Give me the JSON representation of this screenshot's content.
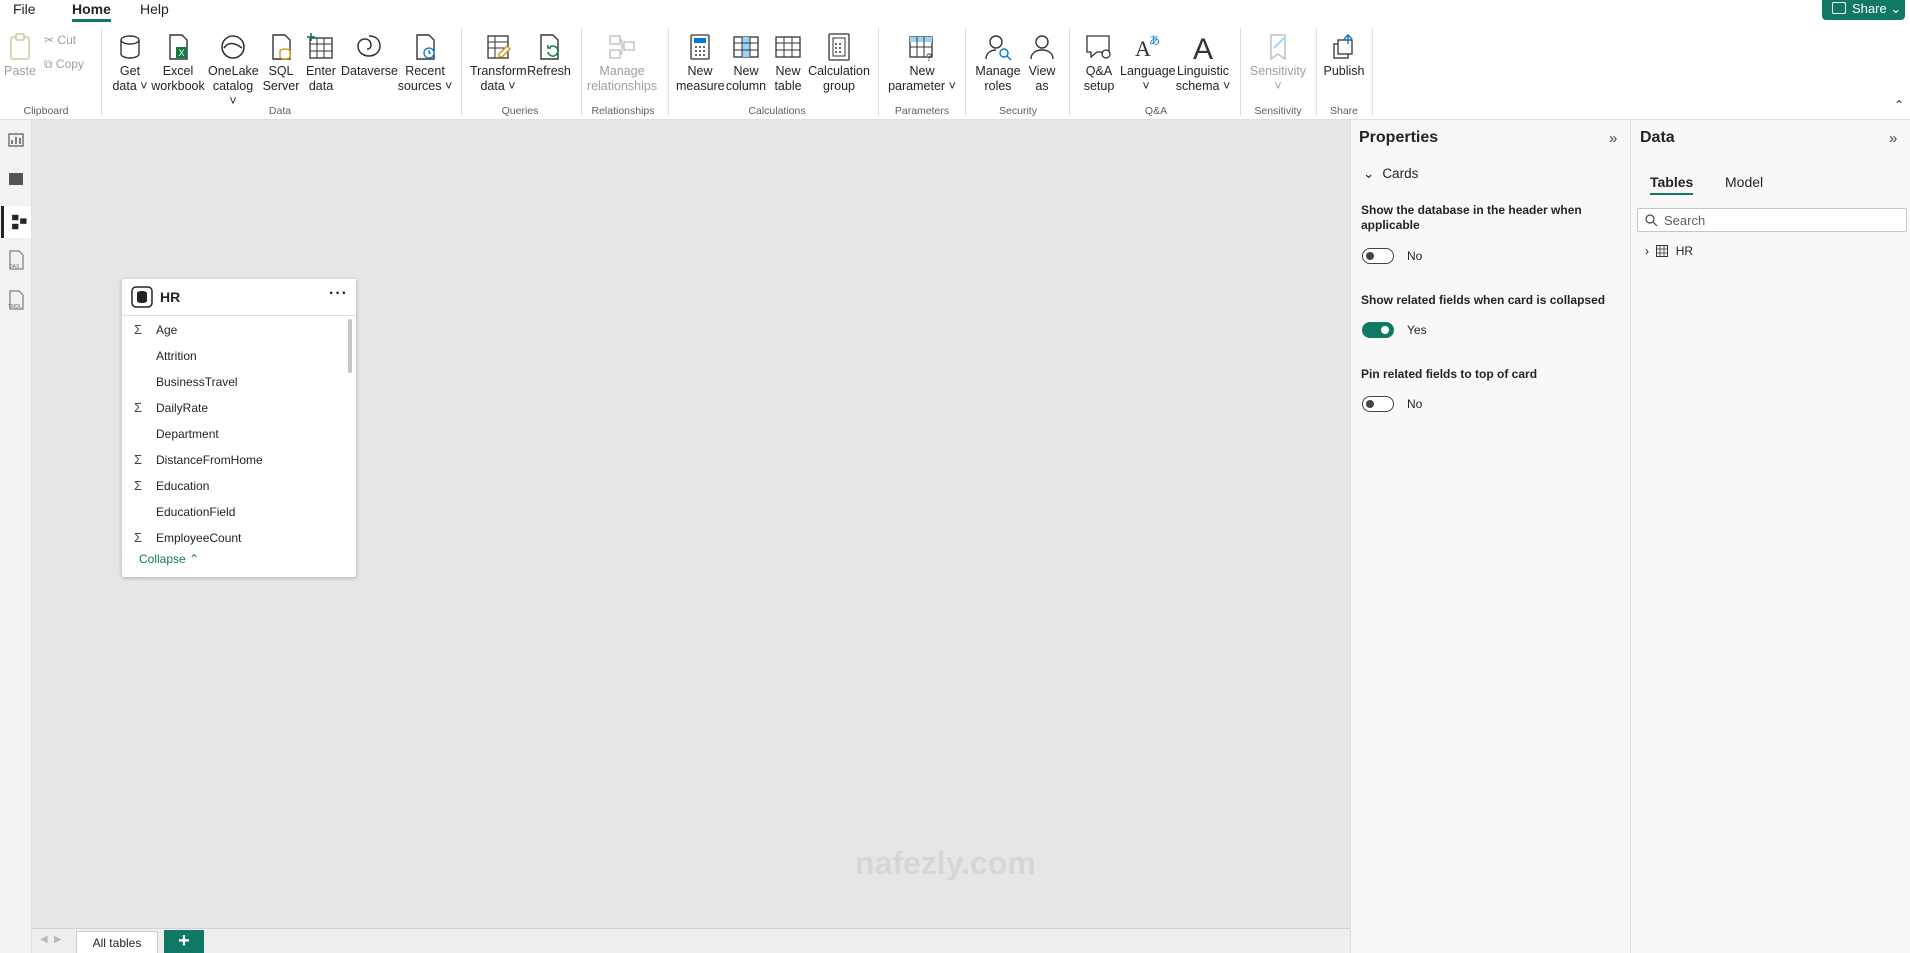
{
  "menu": {
    "file": "File",
    "home": "Home",
    "help": "Help",
    "share": "Share"
  },
  "ribbon": {
    "clipboard": {
      "paste": "Paste",
      "cut": "Cut",
      "copy": "Copy",
      "group": "Clipboard"
    },
    "data": {
      "get_data": [
        "Get",
        "data"
      ],
      "excel": [
        "Excel",
        "workbook"
      ],
      "onelake": [
        "OneLake",
        "catalog"
      ],
      "sql": [
        "SQL",
        "Server"
      ],
      "enter": [
        "Enter",
        "data"
      ],
      "dataverse": "Dataverse",
      "recent": [
        "Recent",
        "sources"
      ],
      "group": "Data"
    },
    "queries": {
      "transform": [
        "Transform",
        "data"
      ],
      "refresh": "Refresh",
      "group": "Queries"
    },
    "relationships": {
      "manage": [
        "Manage",
        "relationships"
      ],
      "group": "Relationships"
    },
    "calculations": {
      "new_measure": [
        "New",
        "measure"
      ],
      "new_column": [
        "New",
        "column"
      ],
      "new_table": [
        "New",
        "table"
      ],
      "calc_group": [
        "Calculation",
        "group"
      ],
      "group": "Calculations"
    },
    "parameters": {
      "new_param": [
        "New",
        "parameter"
      ],
      "group": "Parameters"
    },
    "security": {
      "manage_roles": [
        "Manage",
        "roles"
      ],
      "view_as": [
        "View",
        "as"
      ],
      "group": "Security"
    },
    "qa": {
      "qa_setup": [
        "Q&A",
        "setup"
      ],
      "language": "Language",
      "linguistic": [
        "Linguistic",
        "schema"
      ],
      "group": "Q&A"
    },
    "sensitivity": {
      "label": "Sensitivity",
      "group": "Sensitivity"
    },
    "share": {
      "publish": "Publish",
      "group": "Share"
    }
  },
  "hr_card": {
    "title": "HR",
    "more": "···",
    "fields": [
      {
        "name": "Age",
        "sigma": true
      },
      {
        "name": "Attrition",
        "sigma": false
      },
      {
        "name": "BusinessTravel",
        "sigma": false
      },
      {
        "name": "DailyRate",
        "sigma": true
      },
      {
        "name": "Department",
        "sigma": false
      },
      {
        "name": "DistanceFromHome",
        "sigma": true
      },
      {
        "name": "Education",
        "sigma": true
      },
      {
        "name": "EducationField",
        "sigma": false
      },
      {
        "name": "EmployeeCount",
        "sigma": true
      }
    ],
    "collapse": "Collapse"
  },
  "properties": {
    "title": "Properties",
    "section": "Cards",
    "options": [
      {
        "label": "Show the database in the header when applicable",
        "value": "No",
        "on": false
      },
      {
        "label": "Show related fields when card is collapsed",
        "value": "Yes",
        "on": true
      },
      {
        "label": "Pin related fields to top of card",
        "value": "No",
        "on": false
      }
    ]
  },
  "data_pane": {
    "title": "Data",
    "tabs": [
      "Tables",
      "Model"
    ],
    "search_placeholder": "Search",
    "tables": [
      "HR"
    ]
  },
  "bottom": {
    "tab": "All tables",
    "add": "+"
  },
  "watermark": "nafezly.com",
  "colors": {
    "accent": "#117865",
    "canvas": "#e6e6e6"
  }
}
